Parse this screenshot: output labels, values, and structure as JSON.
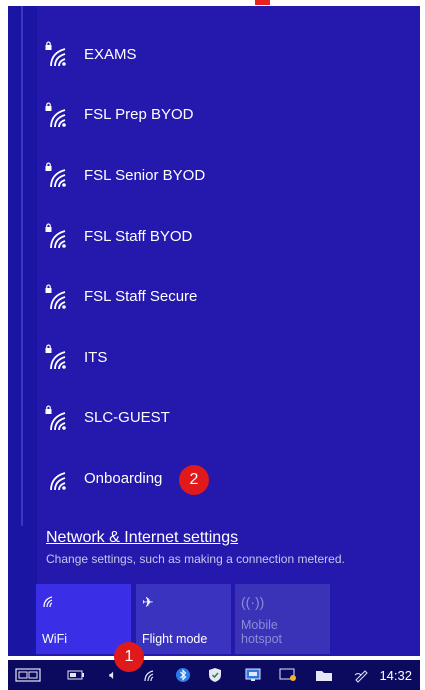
{
  "networks": [
    {
      "label": "EXAMS",
      "secured": true
    },
    {
      "label": "FSL Prep BYOD",
      "secured": true
    },
    {
      "label": "FSL Senior BYOD",
      "secured": true
    },
    {
      "label": "FSL Staff BYOD",
      "secured": true
    },
    {
      "label": "FSL Staff Secure",
      "secured": true
    },
    {
      "label": "ITS",
      "secured": true
    },
    {
      "label": "SLC-GUEST",
      "secured": true
    },
    {
      "label": "Onboarding",
      "secured": false
    }
  ],
  "badges": {
    "first": "1",
    "second": "2"
  },
  "settings": {
    "link": "Network & Internet settings",
    "description": "Change settings, such as making a connection metered."
  },
  "tiles": {
    "wifi": "WiFi",
    "flight": "Flight mode",
    "hotspot_line1": "Mobile",
    "hotspot_line2": "hotspot"
  },
  "taskbar": {
    "time": "14:32"
  },
  "colors": {
    "accent": "#3a2ee6",
    "panel": "#2418ad",
    "badge": "#e0191a"
  }
}
